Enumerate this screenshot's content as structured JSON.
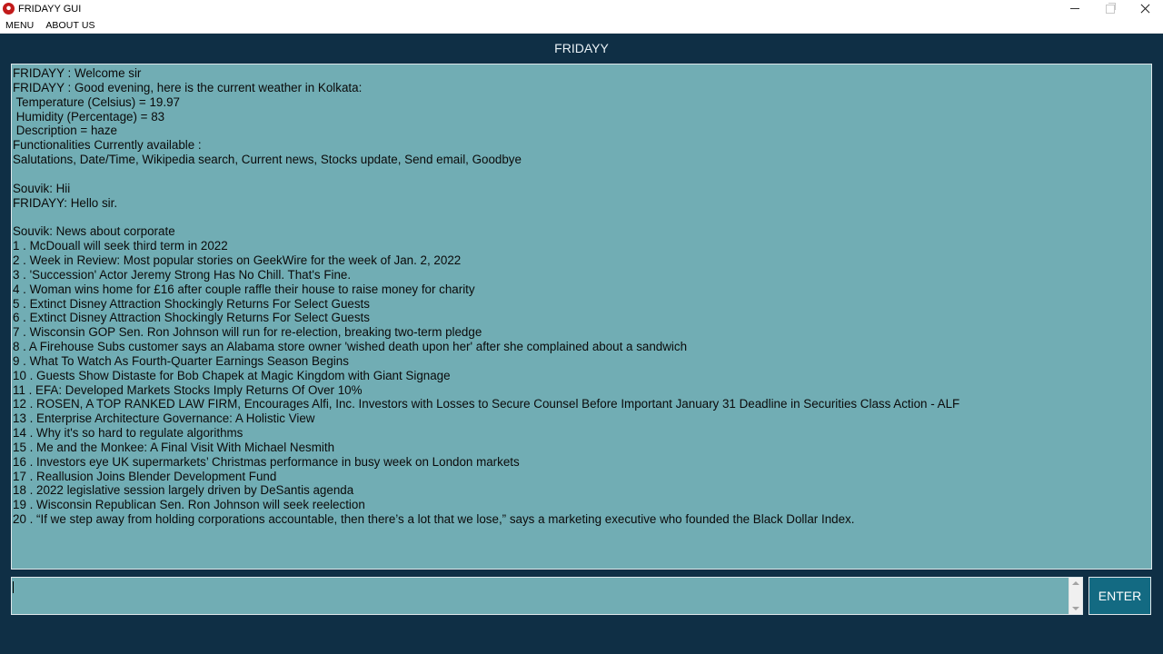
{
  "window": {
    "title": "FRIDAYY GUI"
  },
  "menubar": {
    "items": [
      "MENU",
      "ABOUT US"
    ]
  },
  "app": {
    "heading": "FRIDAYY"
  },
  "chat": {
    "lines": [
      "FRIDAYY : Welcome sir",
      "FRIDAYY : Good evening, here is the current weather in Kolkata:",
      " Temperature (Celsius) = 19.97",
      " Humidity (Percentage) = 83",
      " Description = haze",
      "Functionalities Currently available :",
      "Salutations, Date/Time, Wikipedia search, Current news, Stocks update, Send email, Goodbye",
      "",
      "Souvik: Hii",
      "FRIDAYY: Hello sir.",
      "",
      "Souvik: News about corporate",
      "1 . McDouall will seek third term in 2022",
      "2 . Week in Review: Most popular stories on GeekWire for the week of Jan. 2, 2022",
      "3 . 'Succession' Actor Jeremy Strong Has No Chill. That's Fine.",
      "4 . Woman wins home for £16 after couple raffle their house to raise money for charity",
      "5 . Extinct Disney Attraction Shockingly Returns For Select Guests",
      "6 . Extinct Disney Attraction Shockingly Returns For Select Guests",
      "7 . Wisconsin GOP Sen. Ron Johnson will run for re-election, breaking two-term pledge",
      "8 . A Firehouse Subs customer says an Alabama store owner 'wished death upon her' after she complained about a sandwich",
      "9 . What To Watch As Fourth-Quarter Earnings Season Begins",
      "10 . Guests Show Distaste for Bob Chapek at Magic Kingdom with Giant Signage",
      "11 . EFA: Developed Markets Stocks Imply Returns Of Over 10%",
      "12 . ROSEN, A TOP RANKED LAW FIRM, Encourages Alfi, Inc. Investors with Losses to Secure Counsel Before Important January 31 Deadline in Securities Class Action - ALF",
      "13 . Enterprise Architecture Governance: A Holistic View",
      "14 . Why it's so hard to regulate algorithms",
      "15 . Me and the Monkee: A Final Visit With Michael Nesmith",
      "16 . Investors eye UK supermarkets’ Christmas performance in busy week on London markets",
      "17 . Reallusion Joins Blender Development Fund",
      "18 . 2022 legislative session largely driven by DeSantis agenda",
      "19 . Wisconsin Republican Sen. Ron Johnson will seek reelection",
      "20 . “If we step away from holding corporations accountable, then there’s a lot that we lose,” says a marketing executive who founded the Black Dollar Index."
    ]
  },
  "input": {
    "value": ""
  },
  "enter_button": {
    "label": "ENTER"
  },
  "colors": {
    "background": "#0f2f45",
    "panel": "#71adb4",
    "button": "#136a82",
    "app_icon": "#c21a1a"
  },
  "icons": {
    "app": "app-logo-icon",
    "minimize": "minimize-icon",
    "maximize": "maximize-icon",
    "close": "close-icon"
  }
}
